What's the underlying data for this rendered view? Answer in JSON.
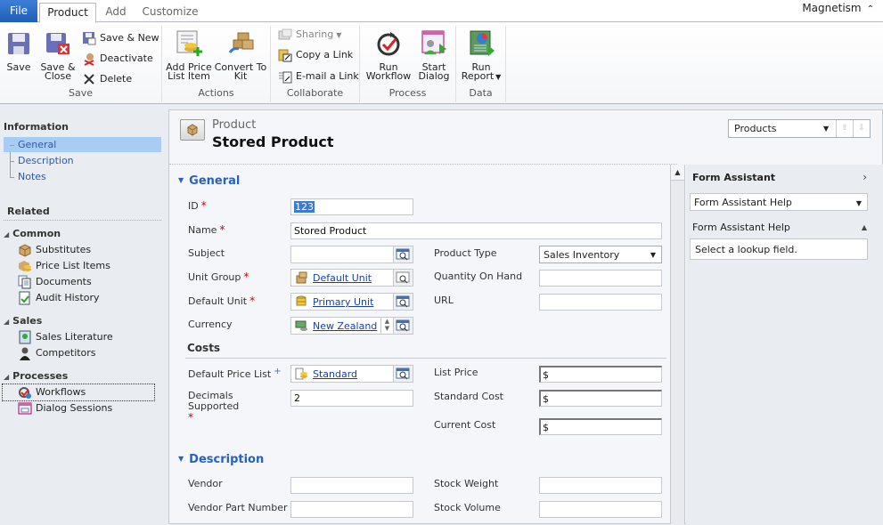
{
  "ribbon": {
    "tabs": [
      {
        "label": "File"
      },
      {
        "label": "Product",
        "active": true
      },
      {
        "label": "Add"
      },
      {
        "label": "Customize"
      }
    ],
    "user": "Magnetism",
    "groups": {
      "save": {
        "label": "Save",
        "save": "Save",
        "save_close_1": "Save &",
        "save_close_2": "Close",
        "save_new": "Save & New",
        "deactivate": "Deactivate",
        "delete": "Delete"
      },
      "actions": {
        "label": "Actions",
        "add_price_1": "Add Price",
        "add_price_2": "List Item",
        "convert_1": "Convert To",
        "convert_2": "Kit"
      },
      "collaborate": {
        "label": "Collaborate",
        "sharing": "Sharing",
        "copy_link": "Copy a Link",
        "email_link": "E-mail a Link"
      },
      "process": {
        "label": "Process",
        "run_wf_1": "Run",
        "run_wf_2": "Workflow",
        "start_dialog_1": "Start",
        "start_dialog_2": "Dialog"
      },
      "data": {
        "label": "Data",
        "run_report_1": "Run",
        "run_report_2": "Report"
      }
    }
  },
  "nav": {
    "information_label": "Information",
    "info_items": [
      "General",
      "Description",
      "Notes"
    ],
    "selected": "General",
    "related_label": "Related",
    "groups": [
      {
        "label": "Common",
        "items": [
          "Substitutes",
          "Price List Items",
          "Documents",
          "Audit History"
        ]
      },
      {
        "label": "Sales",
        "items": [
          "Sales Literature",
          "Competitors"
        ]
      },
      {
        "label": "Processes",
        "items": [
          "Workflows",
          "Dialog Sessions"
        ]
      }
    ]
  },
  "header": {
    "entity": "Product",
    "title": "Stored Product",
    "record_selector": "Products"
  },
  "form": {
    "general_section": "General",
    "id_label": "ID",
    "id_value": "123",
    "name_label": "Name",
    "name_value": "Stored Product",
    "subject_label": "Subject",
    "subject_value": "",
    "product_type_label": "Product Type",
    "product_type_value": "Sales Inventory",
    "unit_group_label": "Unit Group",
    "unit_group_value": "Default Unit",
    "qty_label": "Quantity On Hand",
    "qty_value": "",
    "default_unit_label": "Default Unit",
    "default_unit_value": "Primary Unit",
    "url_label": "URL",
    "url_value": "",
    "currency_label": "Currency",
    "currency_value": "New Zealand",
    "costs_label": "Costs",
    "price_list_label": "Default Price List",
    "price_list_value": "Standard",
    "list_price_label": "List Price",
    "list_price_value": "$",
    "decimals_label": "Decimals Supported",
    "decimals_value": "2",
    "standard_cost_label": "Standard Cost",
    "standard_cost_value": "$",
    "current_cost_label": "Current Cost",
    "current_cost_value": "$",
    "description_section": "Description",
    "vendor_label": "Vendor",
    "vendor_value": "",
    "stock_weight_label": "Stock Weight",
    "stock_weight_value": "",
    "vendor_part_label": "Vendor Part Number",
    "vendor_part_value": "",
    "stock_volume_label": "Stock Volume",
    "stock_volume_value": "",
    "required_mark": "*",
    "recommended_mark": "+"
  },
  "form_assistant": {
    "title": "Form Assistant",
    "dropdown": "Form Assistant Help",
    "help_header": "Form Assistant Help",
    "help_text": "Select a lookup field."
  },
  "colors": {
    "accent": "#2561c5",
    "link": "#1a3fa8",
    "selection": "#a8cdf5",
    "required": "#cc0000"
  }
}
